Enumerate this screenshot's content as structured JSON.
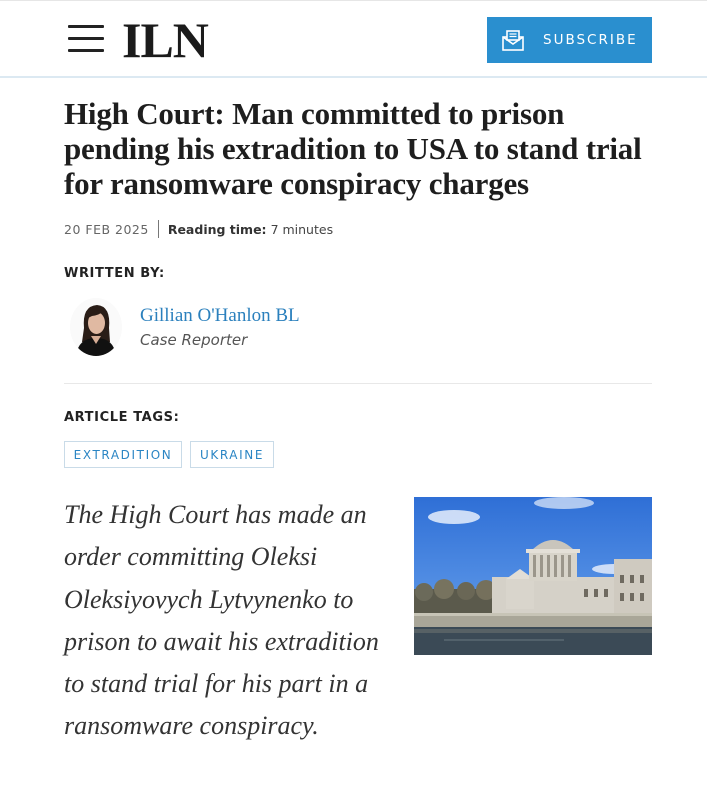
{
  "header": {
    "logo": "ILN",
    "subscribe_label": "SUBSCRIBE",
    "accent_color": "#2a8fcf"
  },
  "article": {
    "title": "High Court: Man committed to prison pending his extradition to USA to stand trial for ransomware conspiracy charges",
    "date": "20 FEB 2025",
    "reading_time_label": "Reading time:",
    "reading_time_value": "7 minutes",
    "written_by_heading": "WRITTEN BY:",
    "author": {
      "name": "Gillian O'Hanlon BL",
      "role": "Case Reporter"
    },
    "tags_heading": "ARTICLE TAGS:",
    "tags": [
      "EXTRADITION",
      "UKRAINE"
    ],
    "lede": "The High Court has made an order committing Oleksi Oleksiyovych Lytvynenko to prison to await his extradition to stand trial for his part in a ransomware conspiracy."
  },
  "icons": {
    "menu": "hamburger-icon",
    "subscribe": "envelope-icon"
  }
}
